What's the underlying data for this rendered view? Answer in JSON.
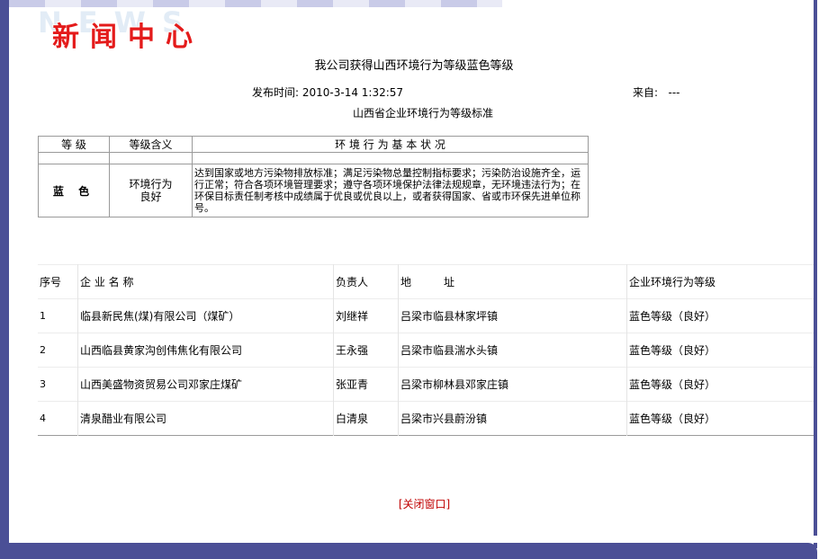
{
  "header": {
    "watermark": "NEWS",
    "section_title": "新闻中心"
  },
  "article": {
    "title": "我公司获得山西环境行为等级蓝色等级",
    "publish_time_label": "发布时间:",
    "publish_time": "2010-3-14 1:32:57",
    "source_label": "来自:",
    "source": "---",
    "subtitle": "山西省企业环境行为等级标准"
  },
  "standard_table": {
    "headers": [
      "等 级",
      "等级含义",
      "环 境 行 为 基 本 状 况"
    ],
    "row": {
      "grade": "蓝 色",
      "meaning": "环境行为良好",
      "description": "达到国家或地方污染物排放标准；满足污染物总量控制指标要求；污染防治设施齐全，运行正常；符合各项环境管理要求；遵守各项环境保护法律法规规章，无环境违法行为；在环保目标责任制考核中成绩属于优良或优良以上，或者获得国家、省或市环保先进单位称号。"
    }
  },
  "company_table": {
    "headers": [
      "序号",
      "企 业 名 称",
      "负责人",
      "地　　　址",
      "企业环境行为等级"
    ],
    "rows": [
      [
        "1",
        "临县新民焦(煤)有限公司（煤矿）",
        "刘继祥",
        "吕梁市临县林家坪镇",
        "蓝色等级（良好）"
      ],
      [
        "2",
        "山西临县黄家沟创伟焦化有限公司",
        "王永强",
        "吕梁市临县湍水头镇",
        "蓝色等级（良好）"
      ],
      [
        "3",
        "山西美盛物资贸易公司邓家庄煤矿",
        "张亚青",
        "吕梁市柳林县邓家庄镇",
        "蓝色等级（良好）"
      ],
      [
        "4",
        "清泉醋业有限公司",
        "白清泉",
        "吕梁市兴县蔚汾镇",
        "蓝色等级（良好）"
      ]
    ]
  },
  "footer": {
    "close_link": "[关闭窗口]"
  },
  "colors": {
    "frame": "#4b4f96",
    "title_red": "#e41b1b",
    "link_red": "#c00000"
  }
}
